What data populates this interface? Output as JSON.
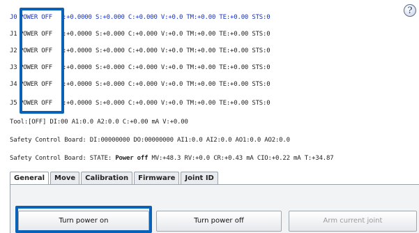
{
  "help_glyph": "?",
  "joints": [
    {
      "id": "J0",
      "power": "POWER OFF",
      "readout": ":+0.0000 S:+0.000 C:+0.000 V:+0.0 TM:+0.00 TE:+0.00 STS:0"
    },
    {
      "id": "J1",
      "power": "POWER OFF",
      "readout": ":+0.0000 S:+0.000 C:+0.000 V:+0.0 TM:+0.00 TE:+0.00 STS:0"
    },
    {
      "id": "J2",
      "power": "POWER OFF",
      "readout": ":+0.0000 S:+0.000 C:+0.000 V:+0.0 TM:+0.00 TE:+0.00 STS:0"
    },
    {
      "id": "J3",
      "power": "POWER OFF",
      "readout": ":+0.0000 S:+0.000 C:+0.000 V:+0.0 TM:+0.00 TE:+0.00 STS:0"
    },
    {
      "id": "J4",
      "power": "POWER OFF",
      "readout": ":+0.0000 S:+0.000 C:+0.000 V:+0.0 TM:+0.00 TE:+0.00 STS:0"
    },
    {
      "id": "J5",
      "power": "POWER OFF",
      "readout": ":+0.0000 S:+0.000 C:+0.000 V:+0.0 TM:+0.00 TE:+0.00 STS:0"
    }
  ],
  "tool_line": "Tool:[OFF] DI:00  A1:0.0 A2:0.0 C:+0.00 mA V:+0.00",
  "safety_io_line": "Safety Control Board: DI:00000000 DO:00000000 AI1:0.0 AI2:0.0 AO1:0.0 AO2:0.0",
  "safety_state": {
    "prefix": "Safety Control Board: STATE: ",
    "state": "Power off",
    "suffix": " MV:+48.3 RV:+0.0 CR:+0.43 mA CIO:+0.22 mA T:+34.87"
  },
  "tabs": [
    "General",
    "Move",
    "Calibration",
    "Firmware",
    "Joint ID"
  ],
  "buttons": {
    "power_on": "Turn power on",
    "power_off": "Turn power off",
    "arm_joint": "Arm current joint"
  },
  "colors": {
    "highlight": "#0a62b8",
    "active_row": "#1530c8"
  }
}
